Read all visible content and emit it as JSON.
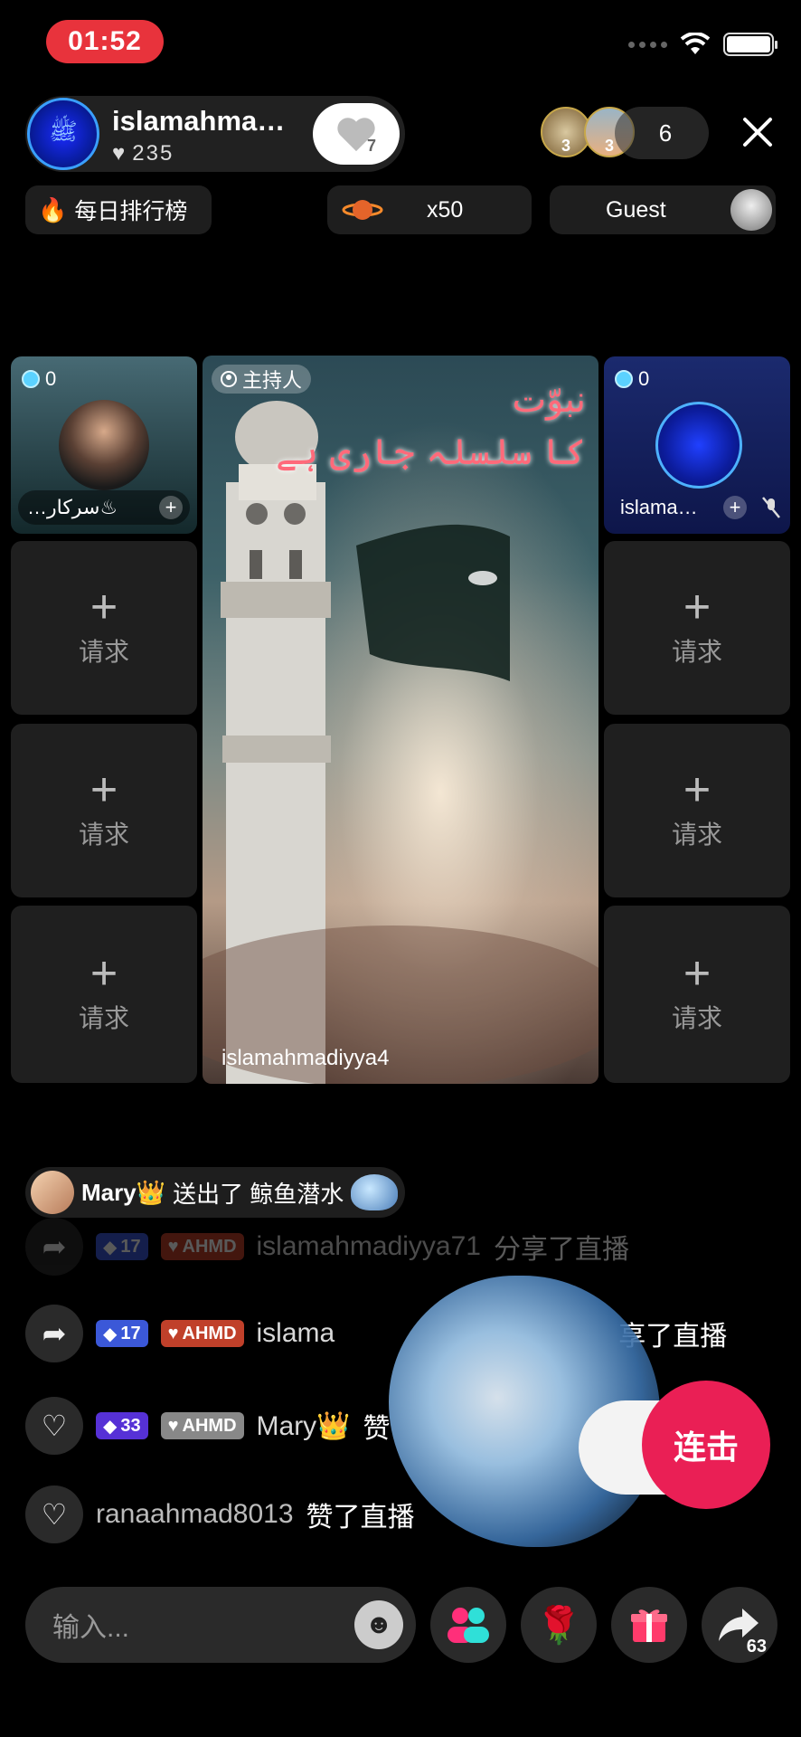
{
  "status": {
    "time": "01:52"
  },
  "host": {
    "name": "islamahma…",
    "likes": "235",
    "follow_count": "7"
  },
  "viewers": {
    "badge1": "3",
    "badge2": "3",
    "count": "6"
  },
  "top_pills": {
    "ranking": "每日排行榜",
    "multiplier": "x50",
    "guest": "Guest"
  },
  "grid": {
    "guest_left": {
      "score": "0",
      "name": "…سرکار♨"
    },
    "guest_right": {
      "score": "0",
      "name": "islama…"
    },
    "request_label": "请求",
    "main": {
      "host_tag": "主持人",
      "username": "islamahmadiyya4",
      "overlay_line1": "نبوّت",
      "overlay_line2": "کا سلسلہ جاری ہے"
    }
  },
  "gift_notice": {
    "user": "Mary👑",
    "text": "送出了 鲸鱼潜水"
  },
  "chat": [
    {
      "level": "17",
      "tag": "AHMD",
      "name": "islamahmadiyya71",
      "text": "分享了直播"
    },
    {
      "level": "17",
      "tag": "AHMD",
      "name": "islama",
      "text": "享了直播"
    },
    {
      "level": "33",
      "tag": "AHMD",
      "name": "Mary👑",
      "text": "赞"
    },
    {
      "name": "ranaahmad8013",
      "text": "赞了直播"
    }
  ],
  "combo": {
    "label": "连击"
  },
  "bottom": {
    "input_placeholder": "输入...",
    "share_count": "63"
  },
  "colors": {
    "accent_red": "#e8333c",
    "combo_pink": "#ea1f55"
  }
}
